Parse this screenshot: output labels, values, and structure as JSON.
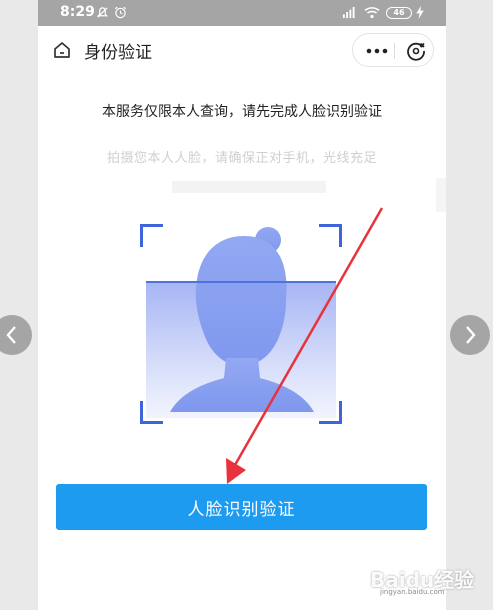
{
  "status_bar": {
    "time": "8:29",
    "battery": "46"
  },
  "header": {
    "title": "身份验证"
  },
  "notice": "本服务仅限本人查询，请先完成人脸识别验证",
  "hint": "拍摄您本人人脸，请确保正对手机，光线充足",
  "button": {
    "label": "人脸识别验证"
  },
  "watermark": {
    "text": "Baidu经验",
    "url": "jingyan.baidu.com"
  },
  "colors": {
    "accent": "#1d9bf0",
    "frame": "#3f63d9",
    "arrow": "#e8323c"
  },
  "icons": [
    "home-icon",
    "more-icon",
    "close-icon",
    "alarm-icon",
    "wifi-icon",
    "signal-icon",
    "battery-icon",
    "chevron-left-icon",
    "chevron-right-icon"
  ]
}
